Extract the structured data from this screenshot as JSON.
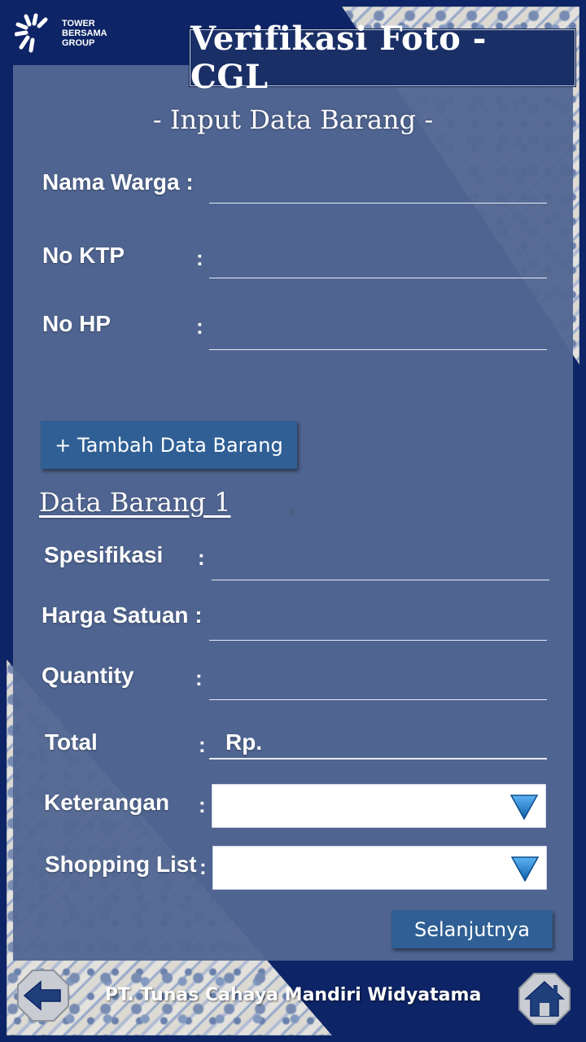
{
  "brand": {
    "logo_lines": [
      "TOWER",
      "BERSAMA",
      "GROUP"
    ]
  },
  "header": {
    "title": "Verifikasi Foto - CGL",
    "subtitle": "- Input Data Barang -"
  },
  "form": {
    "nama_warga_label": "Nama Warga",
    "no_ktp_label": "No KTP",
    "no_hp_label": "No HP",
    "colon": ":",
    "add_button_label": "+ Tambah Data Barang"
  },
  "item": {
    "section_title": "Data Barang 1",
    "spesifikasi_label": "Spesifikasi",
    "harga_label": "Harga Satuan",
    "quantity_label": "Quantity",
    "total_label": "Total",
    "total_value": "Rp.",
    "keterangan_label": "Keterangan",
    "shopping_label": "Shopping List",
    "next_button_label": "Selanjutnya"
  },
  "footer": {
    "company": "PT. Tunas Cahaya Mandiri Widyatama"
  },
  "colors": {
    "background": "#0d2466",
    "panel": "#526792",
    "button": "#2f5f94",
    "title_box": "#1a2f66",
    "dropdown_arrow": "#1f7fd1"
  },
  "icons": {
    "back": "arrow-left-icon",
    "home": "home-icon",
    "dropdown": "triangle-down-icon"
  }
}
